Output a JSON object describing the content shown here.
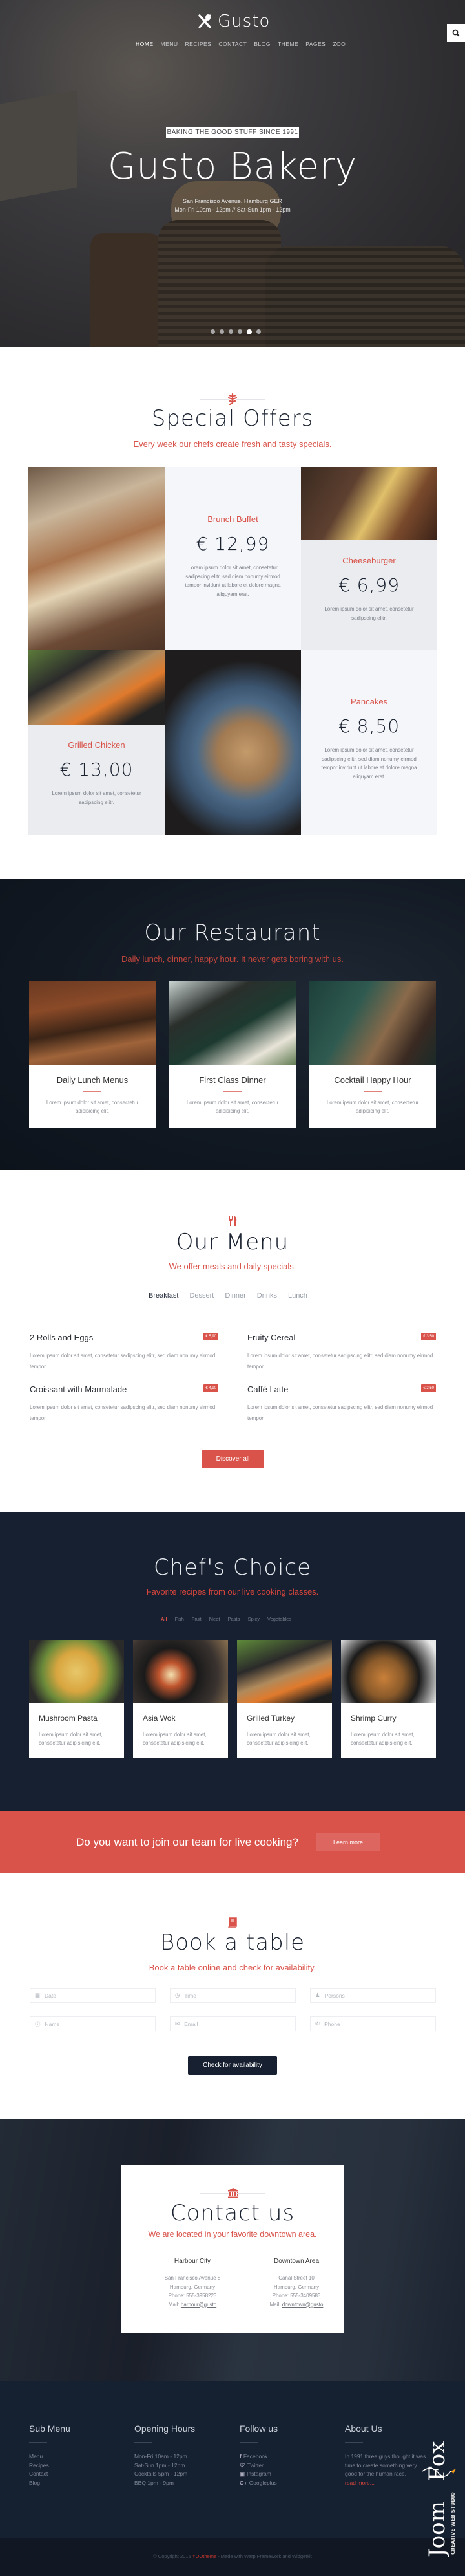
{
  "colors": {
    "accent": "#d9534a",
    "dark": "#172030"
  },
  "header": {
    "logo_text": "Gusto",
    "nav": [
      "HOME",
      "MENU",
      "RECIPES",
      "CONTACT",
      "BLOG",
      "THEME",
      "PAGES",
      "ZOO"
    ],
    "search_icon": "search-icon"
  },
  "hero": {
    "badge": "BAKING THE GOOD STUFF SINCE 1991",
    "title": "Gusto Bakery",
    "address": "San Francisco Avenue, Hamburg GER",
    "hours": "Mon-Fri 10am - 12pm // Sat-Sun 1pm - 12pm",
    "slide_count": 6,
    "active_slide": 5
  },
  "offers": {
    "title": "Special Offers",
    "subtitle": "Every week our chefs create fresh and tasty specials.",
    "items": [
      {
        "name": "Brunch Buffet",
        "price": "€ 12,99",
        "desc": "Lorem ipsum dolor sit amet, consetetur sadipscing elitr, sed diam nonumy eirmod tempor invidunt ut labore et dolore magna aliquyam erat."
      },
      {
        "name": "Cheeseburger",
        "price": "€ 6,99",
        "desc": "Lorem ipsum dolor sit amet, consetetur sadipscing elitr."
      },
      {
        "name": "Grilled Chicken",
        "price": "€ 13,00",
        "desc": "Lorem ipsum dolor sit amet, consetetur sadipscing elitr."
      },
      {
        "name": "Pancakes",
        "price": "€ 8,50",
        "desc": "Lorem ipsum dolor sit amet, consetetur sadipscing elitr, sed diam nonumy eirmod tempor invidunt ut labore et dolore magna aliquyam erat."
      }
    ]
  },
  "restaurant": {
    "title": "Our Restaurant",
    "subtitle": "Daily lunch, dinner, happy hour. It never gets boring with us.",
    "cards": [
      {
        "title": "Daily Lunch Menus",
        "desc": "Lorem ipsum dolor sit amet, consectetur adipisicing elit."
      },
      {
        "title": "First Class Dinner",
        "desc": "Lorem ipsum dolor sit amet, consectetur adipisicing elit."
      },
      {
        "title": "Cocktail Happy Hour",
        "desc": "Lorem ipsum dolor sit amet, consectetur adipisicing elit."
      }
    ]
  },
  "menu": {
    "title": "Our Menu",
    "subtitle": "We offer meals and daily specials.",
    "tabs": [
      "Breakfast",
      "Dessert",
      "Dinner",
      "Drinks",
      "Lunch"
    ],
    "active_tab": "Breakfast",
    "items": [
      {
        "name": "2 Rolls and Eggs",
        "price": "€ 5,90",
        "desc": "Lorem ipsum dolor sit amet, consetetur sadipscing elitr, sed diam nonumy eirmod tempor."
      },
      {
        "name": "Fruity Cereal",
        "price": "€ 3,50",
        "desc": "Lorem ipsum dolor sit amet, consetetur sadipscing elitr, sed diam nonumy eirmod tempor."
      },
      {
        "name": "Croissant with Marmalade",
        "price": "€ 4,90",
        "desc": "Lorem ipsum dolor sit amet, consetetur sadipscing elitr, sed diam nonumy eirmod tempor."
      },
      {
        "name": "Caffé Latte",
        "price": "€ 2,50",
        "desc": "Lorem ipsum dolor sit amet, consetetur sadipscing elitr, sed diam nonumy eirmod tempor."
      }
    ],
    "button": "Discover all"
  },
  "chef": {
    "title": "Chef's Choice",
    "subtitle": "Favorite recipes from our live cooking classes.",
    "filters": [
      "All",
      "Fish",
      "Fruit",
      "Meat",
      "Pasta",
      "Spicy",
      "Vegetables"
    ],
    "active_filter": "All",
    "cards": [
      {
        "title": "Mushroom Pasta",
        "desc": "Lorem ipsum dolor sit amet, consectetur adipisicing elit."
      },
      {
        "title": "Asia Wok",
        "desc": "Lorem ipsum dolor sit amet, consectetur adipisicing elit."
      },
      {
        "title": "Grilled Turkey",
        "desc": "Lorem ipsum dolor sit amet, consectetur adipisicing elit."
      },
      {
        "title": "Shrimp Curry",
        "desc": "Lorem ipsum dolor sit amet, consectetur adipisicing elit."
      }
    ]
  },
  "banner": {
    "text": "Do you want to join our team for live cooking?",
    "button": "Learn more"
  },
  "book": {
    "title": "Book a table",
    "subtitle": "Book a table online and check for availability.",
    "fields": {
      "date": "Date",
      "time": "Time",
      "persons": "Persons",
      "name": "Name",
      "email": "Email",
      "phone": "Phone"
    },
    "button": "Check for availability"
  },
  "contact": {
    "title": "Contact us",
    "subtitle": "We are located in your favorite downtown area.",
    "locations": [
      {
        "name": "Harbour City",
        "street": "San Francisco Avenue 8",
        "city": "Hamburg, Germany",
        "phone": "Phone: 555-3958223",
        "mail_label": "Mail: ",
        "mail": "harbour@gusto"
      },
      {
        "name": "Downtown Area",
        "street": "Canal Street 10",
        "city": "Hamburg, Germany",
        "phone": "Phone: 555-3409583",
        "mail_label": "Mail: ",
        "mail": "downtown@gusto"
      }
    ]
  },
  "footer": {
    "submenu": {
      "title": "Sub Menu",
      "links": [
        "Menu",
        "Recipes",
        "Contact",
        "Blog"
      ]
    },
    "hours": {
      "title": "Opening Hours",
      "lines": [
        "Mon-Fri 10am - 12pm",
        "Sat-Sun 1pm - 12pm",
        "Cocktails 5pm - 12pm",
        "BBQ 1pm - 9pm"
      ]
    },
    "follow": {
      "title": "Follow us",
      "links": [
        "Facebook",
        "Twitter",
        "Instagram",
        "Googleplus"
      ]
    },
    "about": {
      "title": "About Us",
      "text": "In 1991 three guys thought it was time to create something very good for the human race.",
      "link": "read more..."
    },
    "copyright_prefix": "© Copyright 2015 ",
    "copyright_brand": "YOOtheme",
    "copyright_suffix": " - Made with Warp Framework and Widgetkit",
    "watermark": "JoomlaFox CREATIVE WEB STUDIO"
  }
}
